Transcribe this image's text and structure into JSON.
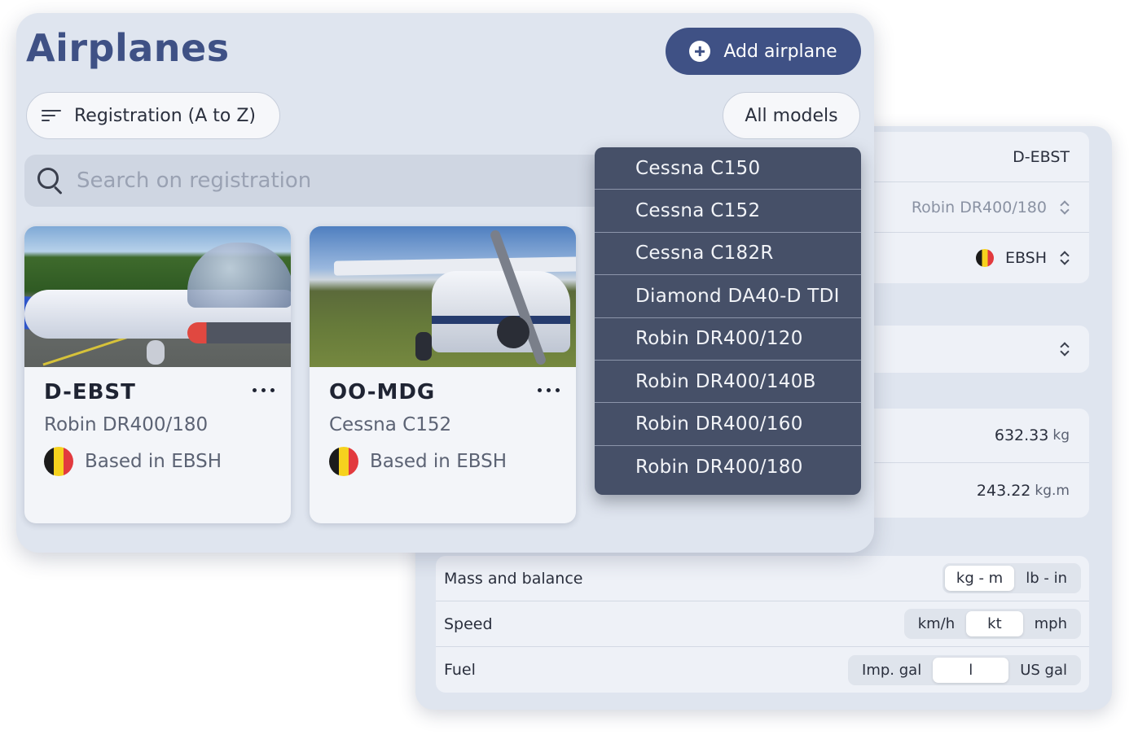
{
  "detail": {
    "registration": "D-EBST",
    "model": "Robin DR400/180",
    "base": "EBSH",
    "empty_mass": "632.33",
    "empty_mass_unit": "kg",
    "empty_moment": "243.22",
    "empty_moment_unit": "kg.m"
  },
  "units": {
    "mass": {
      "label": "Mass and balance",
      "options": [
        "kg - m",
        "lb - in"
      ],
      "selected": 0
    },
    "speed": {
      "label": "Speed",
      "options": [
        "km/h",
        "kt",
        "mph"
      ],
      "selected": 1
    },
    "fuel": {
      "label": "Fuel",
      "options": [
        "Imp. gal",
        "l",
        "US gal"
      ],
      "selected": 1
    }
  },
  "list": {
    "title": "Airplanes",
    "add_label": "Add airplane",
    "sort_label": "Registration (A to Z)",
    "filter_label": "All models",
    "search_placeholder": "Search on registration"
  },
  "cards": [
    {
      "registration": "D-EBST",
      "model": "Robin DR400/180",
      "base": "Based in EBSH"
    },
    {
      "registration": "OO-MDG",
      "model": "Cessna C152",
      "base": "Based in EBSH"
    }
  ],
  "model_menu": [
    "Cessna C150",
    "Cessna C152",
    "Cessna C182R",
    "Diamond DA40-D TDI",
    "Robin DR400/120",
    "Robin DR400/140B",
    "Robin DR400/160",
    "Robin DR400/180"
  ],
  "colors": {
    "accent": "#3f5185",
    "menu_bg": "#465068",
    "panel_bg": "#dfe5ef"
  }
}
